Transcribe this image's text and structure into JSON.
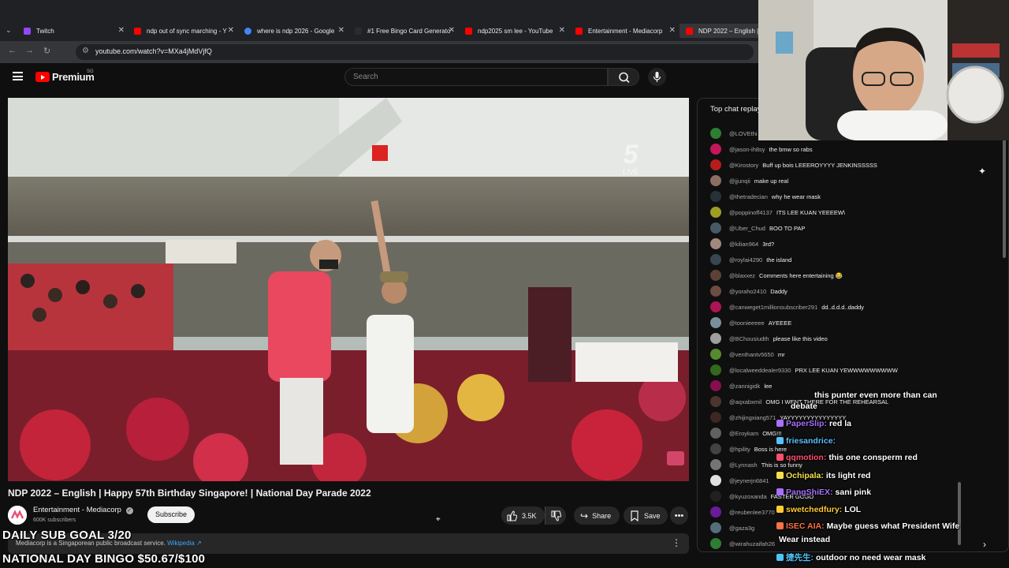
{
  "browser": {
    "tabs": [
      {
        "title": "Twitch",
        "fav": "#9146ff",
        "close": "✕"
      },
      {
        "title": "ndp out of sync marching - Y",
        "fav": "#ff0000",
        "close": "✕"
      },
      {
        "title": "where is ndp 2026 - Google",
        "fav": "#4285f4",
        "close": "✕"
      },
      {
        "title": "#1 Free Bingo Card Generato",
        "fav": "#2b2b2b",
        "close": "✕"
      },
      {
        "title": "ndp2025 sm lee - YouTube",
        "fav": "#ff0000",
        "close": "✕"
      },
      {
        "title": "Entertainment - Mediacorp",
        "fav": "#ff0000",
        "close": "✕"
      },
      {
        "title": "NDP 2022 – English | Ha",
        "fav": "#ff0000",
        "close": ""
      }
    ],
    "url": "youtube.com/watch?v=MXa4jMdVjfQ"
  },
  "header": {
    "logo_text": "Premium",
    "region": "SG",
    "search_placeholder": "Search"
  },
  "video": {
    "title": "NDP 2022 – English | Happy 57th Birthday Singapore! | National Day Parade 2022",
    "channel_name": "Entertainment - Mediacorp",
    "verified_mark": "✓",
    "subscribers": "600K subscribers",
    "subscribe_label": "Subscribe",
    "likes": "3.5K",
    "share_label": "Share",
    "save_label": "Save",
    "description": "Mediacorp is a Singaporean public broadcast service.",
    "wiki_link": "Wikipedia ↗",
    "watermark_channel": "5",
    "watermark_live": "LIVE"
  },
  "chat": {
    "header": "Top chat replay",
    "messages": [
      {
        "author": "@LOVEthi",
        "text": "",
        "color": "#2e7d32"
      },
      {
        "author": "@jason-ih8sy",
        "text": "the bmw so rabs",
        "color": "#c2185b"
      },
      {
        "author": "@Kirostory",
        "text": "Buff up bois LEEEROYYYY JENKINSSSSS",
        "color": "#b71c1c"
      },
      {
        "author": "@jjunqii",
        "text": "make up real",
        "color": "#8d6e63"
      },
      {
        "author": "@thetradecian",
        "text": "why he wear mask",
        "color": "#263238"
      },
      {
        "author": "@poppinoff4137",
        "text": "ITS LEE KUAN YEEEEW\\",
        "color": "#9e9d24"
      },
      {
        "author": "@Uber_Chud",
        "text": "BOO TO PAP",
        "color": "#455a64"
      },
      {
        "author": "@kilian964",
        "text": "3rd?",
        "color": "#a1887f"
      },
      {
        "author": "@roylai4290",
        "text": "the island",
        "color": "#37474f"
      },
      {
        "author": "@blaxxez",
        "text": "Comments here entertaining 😂",
        "color": "#5d4037"
      },
      {
        "author": "@yoraho2410",
        "text": "Daddy",
        "color": "#6d4c41"
      },
      {
        "author": "@canweget1millionsubscriber291",
        "text": "dd..d.d.d..daddy",
        "color": "#ad1457"
      },
      {
        "author": "@toonieeeee",
        "text": "AYEEEE",
        "color": "#78909c"
      },
      {
        "author": "@BChousiudth",
        "text": "please like this video",
        "color": "#9e9e9e"
      },
      {
        "author": "@venthantv5650",
        "text": "mr",
        "color": "#558b2f"
      },
      {
        "author": "@localweeddealer9330",
        "text": "PRX LEE KUAN YEWWWWWWWWW",
        "color": "#33691e"
      },
      {
        "author": "@zannigidk",
        "text": "lee",
        "color": "#880e4f"
      },
      {
        "author": "@aqxabxmil",
        "text": "OMG I WENT THERE FOR THE REHEARSAL",
        "color": "#4e342e"
      },
      {
        "author": "@zhijingxiang571",
        "text": "YAYYYYYYYYYYYYYYY",
        "color": "#3e2723"
      },
      {
        "author": "@Eroykam",
        "text": "OMG!!!",
        "color": "#616161"
      },
      {
        "author": "@hpility",
        "text": "Boss is here",
        "color": "#424242"
      },
      {
        "author": "@Lynnash",
        "text": "This is so funny",
        "color": "#757575"
      },
      {
        "author": "@jeynerjn6841",
        "text": "",
        "color": "#e0e0e0"
      },
      {
        "author": "@kyuzoxanda",
        "text": "FASTER GOGO",
        "color": "#212121"
      },
      {
        "author": "@reubenlee3770",
        "text": "",
        "color": "#6a1b9a"
      },
      {
        "author": "@gaza3g",
        "text": "",
        "color": "#546e7a"
      },
      {
        "author": "@wirahuzaifah26",
        "text": "",
        "color": "#2e7d32"
      }
    ]
  },
  "overlay": {
    "sub_goal": "DAILY SUB GOAL 3/20",
    "bingo": "NATIONAL DAY BINGO $50.67/$100",
    "twitch_chat": [
      {
        "name": "",
        "text": "this punter even more than can",
        "name_color": "#a970ff"
      },
      {
        "name": "",
        "text": "debate",
        "name_color": "#a970ff"
      },
      {
        "name": "PaperSlip:",
        "text": "red la",
        "name_color": "#a970ff"
      },
      {
        "name": "friesandrice:",
        "text": "",
        "name_color": "#5bc0ff"
      },
      {
        "name": "qqmotion:",
        "text": "this one consperm red",
        "name_color": "#ff4f6e"
      },
      {
        "name": "Ochipala:",
        "text": "its light red",
        "name_color": "#f5e04a"
      },
      {
        "name": "PangShiEX:",
        "text": "sani pink",
        "name_color": "#a970ff"
      },
      {
        "name": "swetchedfury:",
        "text": "LOL",
        "name_color": "#ffcc33"
      },
      {
        "name": "ISEC AIA:",
        "text": "Maybe guess what President Wife",
        "name_color": "#ff7043"
      },
      {
        "name": "",
        "text": "Wear instead",
        "name_color": "#ffffff"
      },
      {
        "name": "捷先生:",
        "text": "outdoor no need wear mask",
        "name_color": "#4fc3f7"
      }
    ]
  }
}
